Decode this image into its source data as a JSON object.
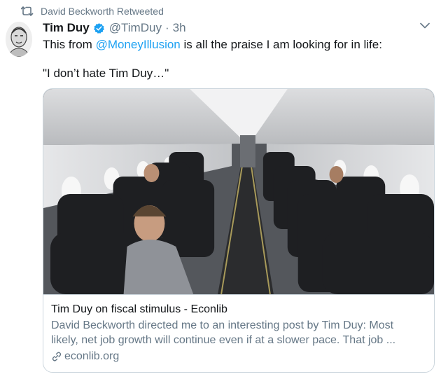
{
  "context": {
    "retweeted_by": "David Beckworth Retweeted"
  },
  "author": {
    "name": "Tim Duy",
    "handle": "@TimDuy",
    "separator": "·",
    "time": "3h"
  },
  "tweet": {
    "text_before": "This from ",
    "mention": "@MoneyIllusion",
    "text_after": " is all the praise I am looking for in life:",
    "quote": "\"I don’t hate Tim Duy…\""
  },
  "card": {
    "title": "Tim Duy on fiscal stimulus - Econlib",
    "description_line1": "David Beckworth directed me to an interesting post by Tim Duy: Most",
    "description_line2": "likely, net job growth will continue even if at a slower pace. That job ...",
    "domain": "econlib.org"
  },
  "icons": {
    "retweet": "retweet-icon",
    "verified": "verified-badge-icon",
    "caret": "chevron-down-icon",
    "link": "link-icon"
  },
  "colors": {
    "accent": "#1da1f2",
    "secondary_text": "#657786",
    "border": "#ccd6dd"
  }
}
